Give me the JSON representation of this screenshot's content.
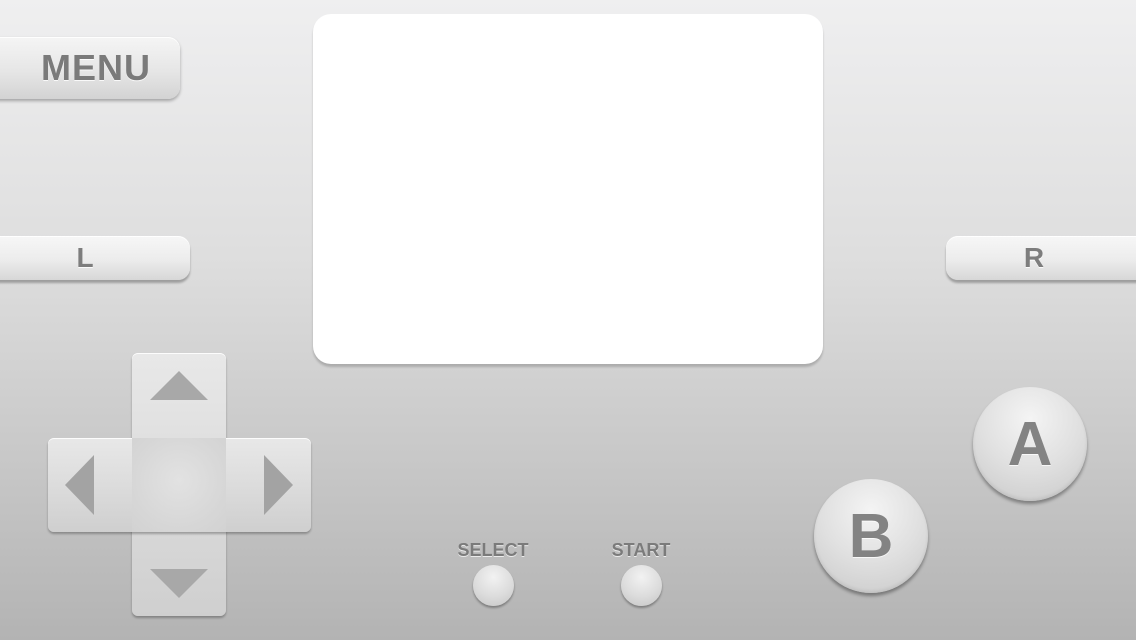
{
  "menu": {
    "label": "MENU"
  },
  "shoulders": {
    "left_label": "L",
    "right_label": "R"
  },
  "center_buttons": {
    "select_label": "SELECT",
    "start_label": "START"
  },
  "face_buttons": {
    "a_label": "A",
    "b_label": "B"
  },
  "dpad": {
    "up_icon": "triangle-up-icon",
    "down_icon": "triangle-down-icon",
    "left_icon": "triangle-left-icon",
    "right_icon": "triangle-right-icon"
  },
  "colors": {
    "background_top": "#efeff0",
    "background_bottom": "#b3b3b3",
    "screen": "#ffffff",
    "label_text": "#7a7a7a",
    "arrow": "#a8a8a8"
  }
}
